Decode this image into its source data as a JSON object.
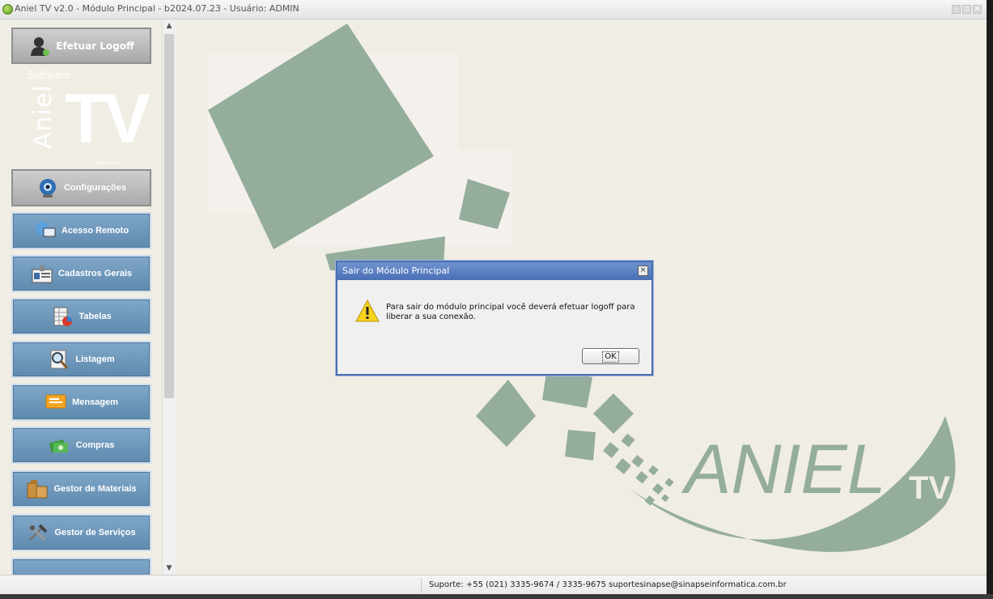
{
  "window": {
    "title": "Aniel TV v2.0 - Módulo Principal - b2024.07.23 - Usuário: ADMIN",
    "controls": [
      "–",
      "▫",
      "×"
    ]
  },
  "sidebar": {
    "logoff_label": "Efetuar Logoff",
    "logo": {
      "software": "Software",
      "aniel": "Aniel",
      "tv": "TV",
      "tagline": "Aniel Total V"
    },
    "items": [
      {
        "label": "Configurações",
        "icon": "webcam-icon",
        "active": true
      },
      {
        "label": "Acesso Remoto",
        "icon": "remote-computer-icon"
      },
      {
        "label": "Cadastros Gerais",
        "icon": "id-card-icon"
      },
      {
        "label": "Tabelas",
        "icon": "table-chart-icon"
      },
      {
        "label": "Listagem",
        "icon": "magnifier-document-icon"
      },
      {
        "label": "Mensagem",
        "icon": "message-icon"
      },
      {
        "label": "Compras",
        "icon": "money-icon"
      },
      {
        "label": "Gestor de Materiais",
        "icon": "boxes-icon"
      },
      {
        "label": "Gestor de Serviços",
        "icon": "tools-icon"
      }
    ]
  },
  "background_logo": {
    "aniel": "ANIEL",
    "tv": "TV"
  },
  "dialog": {
    "title": "Sair do Módulo Principal",
    "message": "Para sair do módulo principal você deverá efetuar logoff para liberar a sua conexão.",
    "ok_label": "OK",
    "close_label": "×"
  },
  "status": {
    "support": "Suporte: +55 (021) 3335-9674 / 3335-9675 suportesinapse@sinapseinformatica.com.br"
  },
  "colors": {
    "menu_blue": "#6e98bd",
    "background": "#f0ede4",
    "shape_green": "#94ad9c",
    "dialog_blue": "#4a6fb0"
  }
}
